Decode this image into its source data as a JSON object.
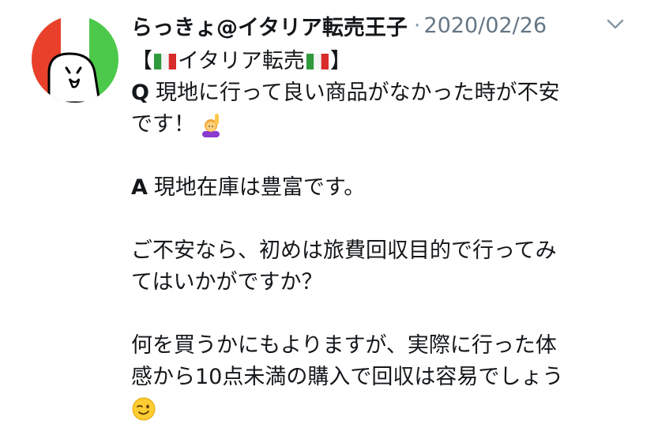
{
  "user": {
    "display_name": "らっきょ@イタリア転売王子",
    "separator": "·",
    "date": "2020/02/26"
  },
  "tweet": {
    "title_open": "【",
    "title_text": "イタリア転売",
    "title_close": "】",
    "q_label": "Q",
    "q_line1": "現地に行って良い商品がなかった時が不安",
    "q_line2": "です！",
    "a_label": "A",
    "a_line1": "現地在庫は豊富です。",
    "p2_line1": "ご不安なら、初めは旅費回収目的で行ってみ",
    "p2_line2": "てはいかがですか？",
    "p3_line1": "何を買うかにもよりますが、実際に行った体",
    "p3_line2": "感から10点未満の購入で回収は容易でしょう"
  },
  "icons": {
    "flag": "italy-flag-icon",
    "raised_hand": "person-raising-hand-emoji",
    "wink": "winking-face-emoji",
    "menu": "chevron-down-icon"
  },
  "colors": {
    "italy_green": "#3fbf4a",
    "italy_red": "#e8402a",
    "muted": "#657786"
  }
}
